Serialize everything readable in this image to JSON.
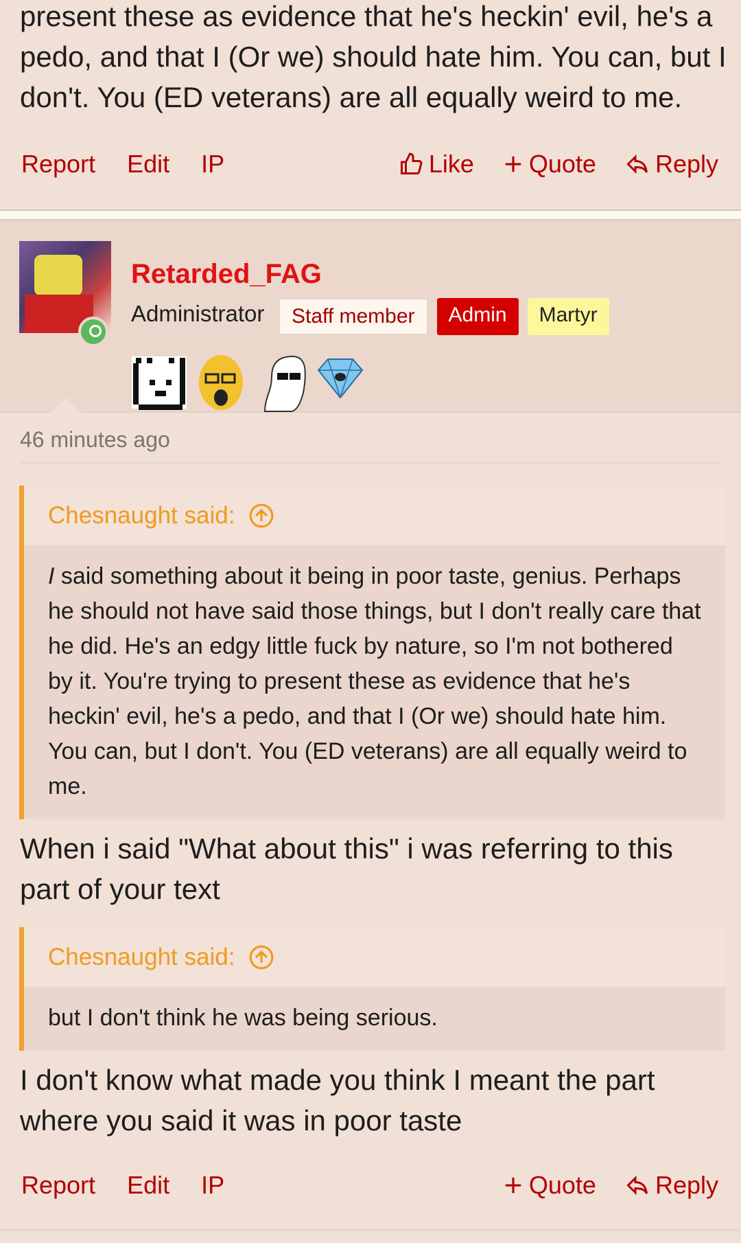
{
  "prev_post": {
    "text": "present these as evidence that he's heckin' evil, he's a pedo, and that I (Or we) should hate him. You can, but I don't. You (ED veterans) are all equally weird to me.",
    "actions": {
      "report": "Report",
      "edit": "Edit",
      "ip": "IP",
      "like": "Like",
      "quote": "Quote",
      "reply": "Reply"
    }
  },
  "post": {
    "username": "Retarded_FAG",
    "user_title": "Administrator",
    "badges": {
      "staff": "Staff member",
      "admin": "Admin",
      "martyr": "Martyr"
    },
    "timestamp": "46 minutes ago",
    "quote1": {
      "author": "Chesnaught said:",
      "body_italic": "I",
      "body": " said something about it being in poor taste, genius. Perhaps he should not have said those things, but I don't really care that he did. He's an edgy little fuck by nature, so I'm not bothered by it. You're trying to present these as evidence that he's heckin' evil, he's a pedo, and that I (Or we) should hate him. You can, but I don't. You (ED veterans) are all equally weird to me."
    },
    "para1": "When i said \"What about this\" i was referring to this part of your text",
    "quote2": {
      "author": "Chesnaught said:",
      "body": "but I don't think he was being serious."
    },
    "para2": "I don't know what made you think I meant the part where you said it was in poor taste",
    "actions": {
      "report": "Report",
      "edit": "Edit",
      "ip": "IP",
      "quote": "Quote",
      "reply": "Reply"
    }
  },
  "colors": {
    "link": "#b30000",
    "username": "#e01212",
    "quote_accent": "#f0a030"
  }
}
